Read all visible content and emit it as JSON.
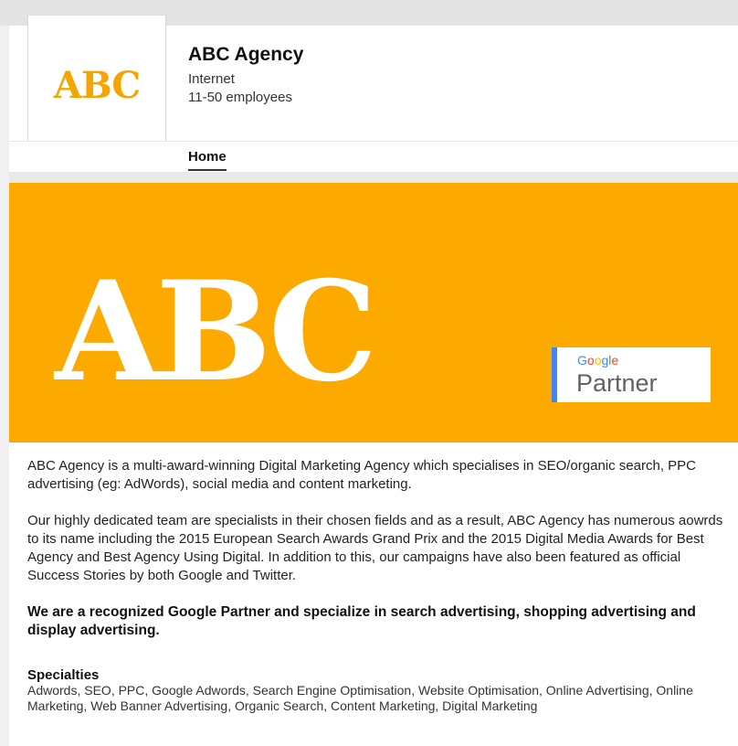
{
  "header": {
    "logo_text": "ABC",
    "company_name": "ABC Agency",
    "industry": "Internet",
    "size": "11-50 employees"
  },
  "tabs": [
    {
      "label": "Home",
      "active": true
    }
  ],
  "banner": {
    "text": "ABC",
    "background_color": "#fdaa00",
    "partner_badge": {
      "google": "Google",
      "partner": "Partner"
    }
  },
  "about": {
    "paragraphs": [
      "ABC Agency is a multi-award-winning Digital Marketing Agency which specialises in SEO/organic search, PPC advertising (eg: AdWords), social media and content marketing.",
      "Our highly dedicated team are specialists in their chosen fields and as a result, ABC Agency has numerous aowrds to its name including the 2015 European Search Awards Grand Prix and the 2015 Digital Media Awards for Best Agency and Best Agency Using Digital. In addition to this, our campaigns have also been featured as official Success Stories by both Google and Twitter."
    ],
    "highlight": "We are a recognized Google Partner and specialize in search advertising, shopping advertising and display advertising."
  },
  "specialties": {
    "title": "Specialties",
    "list": "Adwords, SEO, PPC, Google Adwords, Search Engine Optimisation, Website Optimisation, Online Advertising, Online Marketing, Web Banner Advertising, Organic Search, Content Marketing, Digital Marketing"
  }
}
